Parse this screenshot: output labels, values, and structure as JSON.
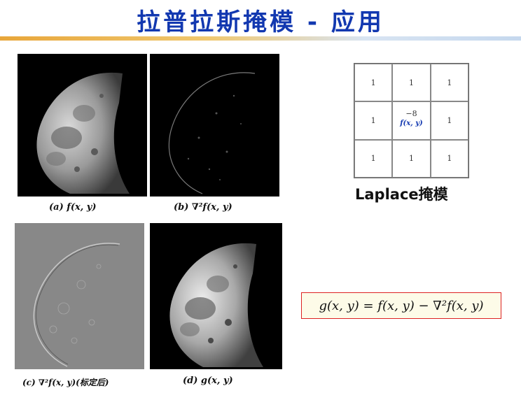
{
  "slide": {
    "title": "拉普拉斯掩模 - 应用"
  },
  "panels": {
    "a": {
      "caption": "(a)   f(x, y)"
    },
    "b": {
      "caption": "(b)   ∇²f(x, y)"
    },
    "c": {
      "caption": "(c) ∇²f(x, y)(标定后)"
    },
    "d": {
      "caption": "(d)   g(x, y)"
    }
  },
  "mask": {
    "cells": [
      "1",
      "1",
      "1",
      "1",
      "−8",
      "1",
      "1",
      "1",
      "1"
    ],
    "center_label": "f(x, y)",
    "title": "Laplace掩模"
  },
  "formula": {
    "text": "g(x, y) = f(x, y) − ∇²f(x, y)"
  },
  "colors": {
    "title": "#1238b0",
    "formula_border": "#dd2222",
    "formula_bg": "#fdfbe8"
  }
}
